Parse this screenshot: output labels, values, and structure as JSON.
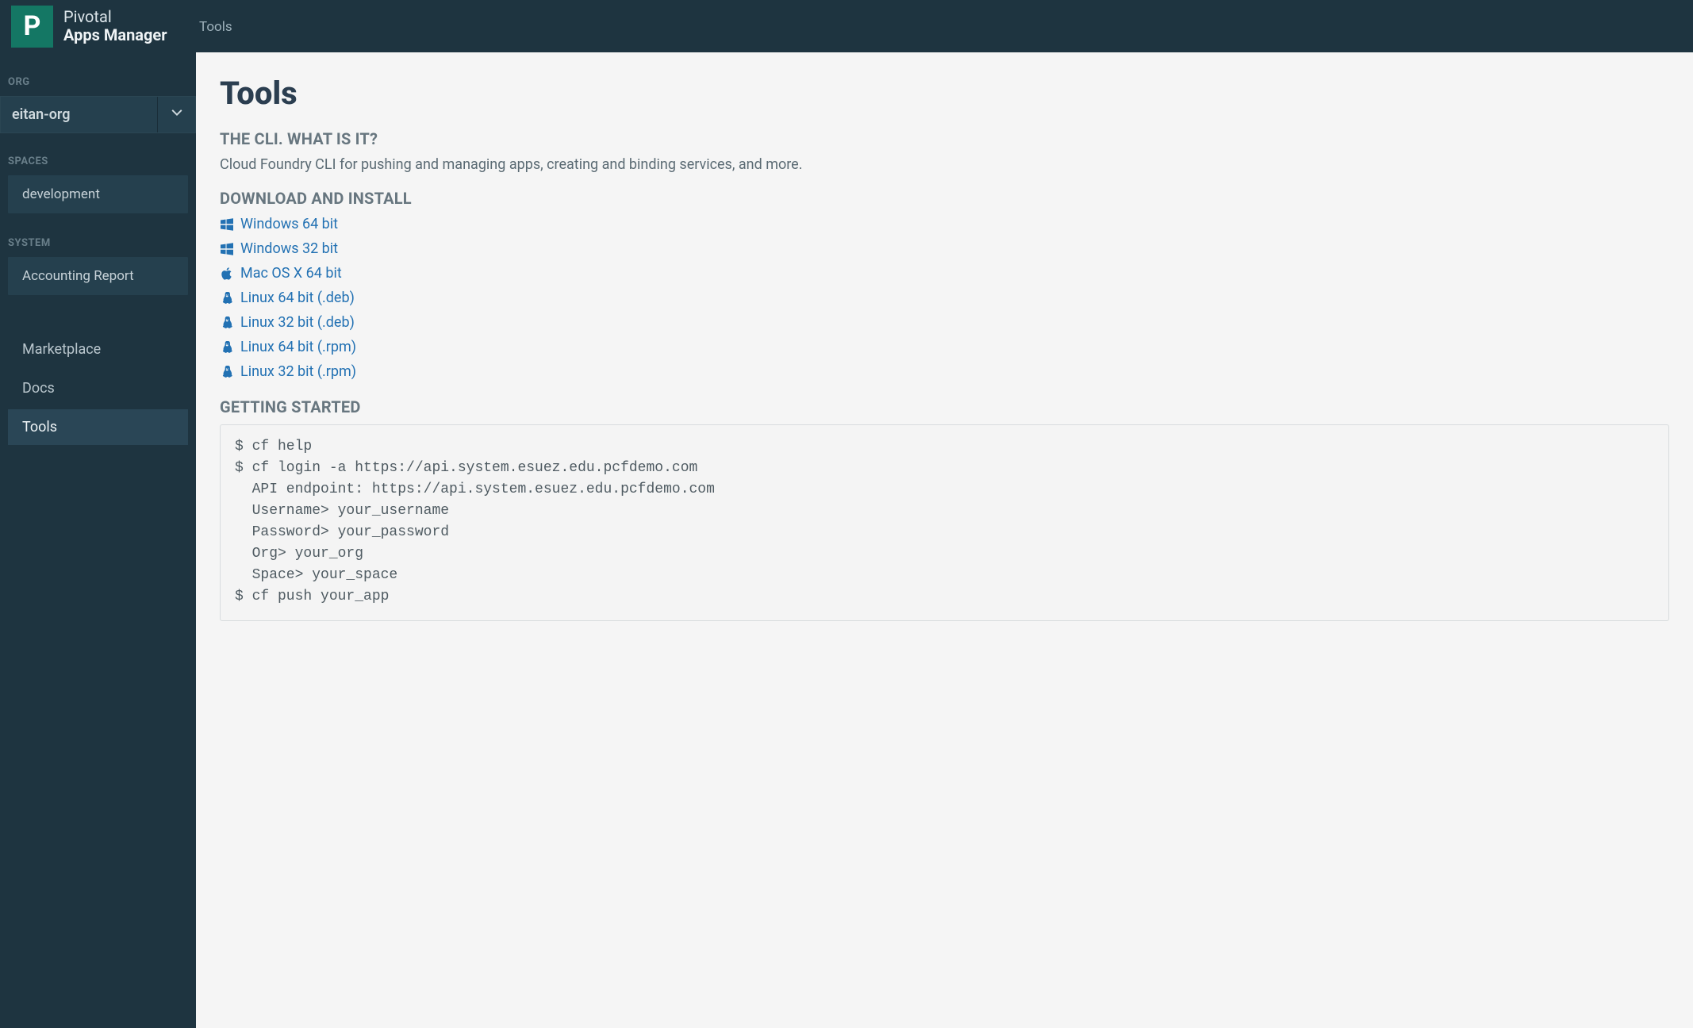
{
  "brand": {
    "logo_letter": "P",
    "line1": "Pivotal",
    "line2": "Apps Manager"
  },
  "breadcrumb": "Tools",
  "sidebar": {
    "org_label": "ORG",
    "org_name": "eitan-org",
    "spaces_label": "SPACES",
    "spaces": [
      {
        "name": "development"
      }
    ],
    "system_label": "SYSTEM",
    "system_items": [
      {
        "name": "Accounting Report"
      }
    ],
    "nav": [
      {
        "label": "Marketplace",
        "active": false
      },
      {
        "label": "Docs",
        "active": false
      },
      {
        "label": "Tools",
        "active": true
      }
    ]
  },
  "page": {
    "title": "Tools",
    "cli_header": "THE CLI. WHAT IS IT?",
    "cli_desc": "Cloud Foundry CLI for pushing and managing apps, creating and binding services, and more.",
    "download_header": "DOWNLOAD AND INSTALL",
    "downloads": [
      {
        "icon": "windows-icon",
        "label": "Windows 64 bit"
      },
      {
        "icon": "windows-icon",
        "label": "Windows 32 bit"
      },
      {
        "icon": "apple-icon",
        "label": "Mac OS X 64 bit"
      },
      {
        "icon": "linux-icon",
        "label": "Linux 64 bit (.deb)"
      },
      {
        "icon": "linux-icon",
        "label": "Linux 32 bit (.deb)"
      },
      {
        "icon": "linux-icon",
        "label": "Linux 64 bit (.rpm)"
      },
      {
        "icon": "linux-icon",
        "label": "Linux 32 bit (.rpm)"
      }
    ],
    "getting_started_header": "GETTING STARTED",
    "code": "$ cf help\n$ cf login -a https://api.system.esuez.edu.pcfdemo.com\n  API endpoint: https://api.system.esuez.edu.pcfdemo.com\n  Username> your_username\n  Password> your_password\n  Org> your_org\n  Space> your_space\n$ cf push your_app"
  }
}
